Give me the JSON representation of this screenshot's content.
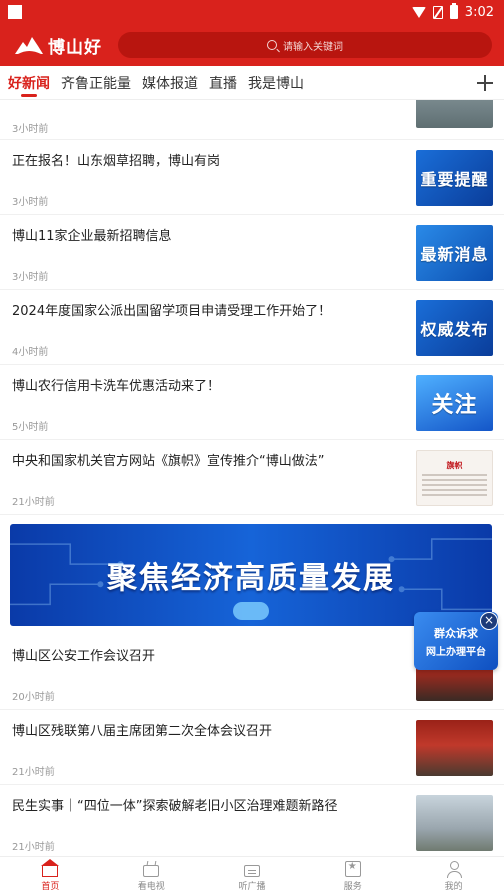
{
  "status_bar": {
    "time": "3:02"
  },
  "header": {
    "logo_text": "博山好",
    "search_placeholder": "请输入关键词"
  },
  "tabs": [
    {
      "label": "好新闻",
      "active": true
    },
    {
      "label": "齐鲁正能量",
      "active": false
    },
    {
      "label": "媒体报道",
      "active": false
    },
    {
      "label": "直播",
      "active": false
    },
    {
      "label": "我是博山",
      "active": false
    }
  ],
  "feed": {
    "first_item": {
      "time": "3小时前"
    },
    "items": [
      {
        "title": "正在报名！山东烟草招聘，博山有岗",
        "time": "3小时前",
        "thumb_text": "重要提醒"
      },
      {
        "title": "博山11家企业最新招聘信息",
        "time": "3小时前",
        "thumb_text": "最新消息"
      },
      {
        "title": "2024年度国家公派出国留学项目申请受理工作开始了！",
        "time": "4小时前",
        "thumb_text": "权威发布"
      },
      {
        "title": "博山农行信用卡洗车优惠活动来了！",
        "time": "5小时前",
        "thumb_text": "关注"
      },
      {
        "title": "中央和国家机关官方网站《旗帜》宣传推介“博山做法”",
        "time": "21小时前",
        "thumb_text": "旗帜"
      }
    ],
    "banner_text": "聚焦经济高质量发展",
    "items_after_banner": [
      {
        "title": "博山区公安工作会议召开",
        "time": "20小时前"
      },
      {
        "title": "博山区残联第八届主席团第二次全体会议召开",
        "time": "21小时前"
      },
      {
        "title": "民生实事｜“四位一体”探索破解老旧小区治理难题新路径",
        "time": "21小时前"
      }
    ]
  },
  "float_ad": {
    "line1": "群众诉求",
    "line2": "网上办理平台",
    "close": "×"
  },
  "bottom_nav": [
    {
      "label": "首页",
      "active": true
    },
    {
      "label": "看电视",
      "active": false
    },
    {
      "label": "听广播",
      "active": false
    },
    {
      "label": "服务",
      "active": false
    },
    {
      "label": "我的",
      "active": false
    }
  ],
  "colors": {
    "brand_red": "#d9221c",
    "banner_blue": "#1664d8"
  }
}
